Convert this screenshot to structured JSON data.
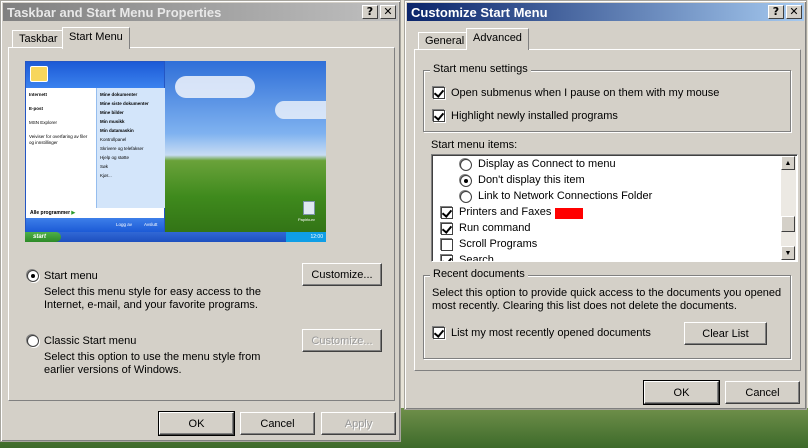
{
  "left_window": {
    "title": "Taskbar and Start Menu Properties",
    "tabs": [
      "Taskbar",
      "Start Menu"
    ],
    "preview": {
      "start_label": "start",
      "clock": "12:00",
      "menu_left": [
        "Internett",
        "E-post",
        "MSN Explorer",
        "Veiviser for overføring av filer og innstillinger"
      ],
      "menu_right": [
        "Mine dokumenter",
        "Mine siste dokumenter",
        "Mine bilder",
        "Min musikk",
        "Min datamaskin",
        "Kontrollpanel",
        "Skrivere og telefakser",
        "Hjelp og støtte",
        "Søk",
        "Kjør..."
      ],
      "all_programs": "Alle programmer",
      "log_off": "Logg av",
      "shut_down": "Avslutt",
      "recycle": "Papirkurv"
    },
    "start_menu_option": {
      "label": "Start menu",
      "description": "Select this menu style for easy access to the Internet, e-mail, and your favorite programs.",
      "button": "Customize..."
    },
    "classic_option": {
      "label": "Classic Start menu",
      "description": "Select this option to use the menu style from earlier versions of Windows.",
      "button": "Customize..."
    },
    "buttons": {
      "ok": "OK",
      "cancel": "Cancel",
      "apply": "Apply"
    }
  },
  "right_window": {
    "title": "Customize Start Menu",
    "tabs": [
      "General",
      "Advanced"
    ],
    "settings_group": {
      "title": "Start menu settings",
      "open_submenus": "Open submenus when I pause on them with my mouse",
      "highlight_new": "Highlight newly installed programs"
    },
    "items_label": "Start menu items:",
    "items": [
      {
        "type": "radio",
        "checked": false,
        "label": "Display as Connect to menu"
      },
      {
        "type": "radio",
        "checked": true,
        "label": "Don't display this item"
      },
      {
        "type": "radio",
        "checked": false,
        "label": "Link to Network Connections Folder"
      },
      {
        "type": "check",
        "checked": true,
        "label": "Printers and Faxes"
      },
      {
        "type": "check",
        "checked": true,
        "label": "Run command"
      },
      {
        "type": "check",
        "checked": false,
        "label": "Scroll Programs"
      },
      {
        "type": "check",
        "checked": true,
        "label": "Search"
      }
    ],
    "recent_group": {
      "title": "Recent documents",
      "description": "Select this option to provide quick access to the documents you opened most recently.  Clearing this list does not delete the documents.",
      "list_recent": "List my most recently opened documents",
      "clear_button": "Clear List"
    },
    "buttons": {
      "ok": "OK",
      "cancel": "Cancel"
    }
  }
}
